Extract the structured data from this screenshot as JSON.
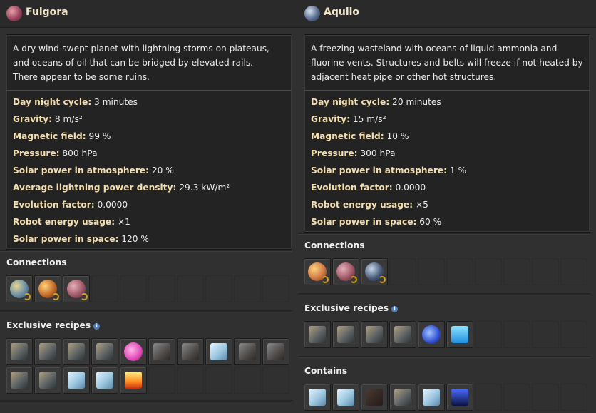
{
  "left": {
    "name": "Fulgora",
    "description": "A dry wind-swept planet with lightning storms on plateaus, and oceans of oil that can be bridged by elevated rails.\nThere appear to be some ruins.",
    "stats": [
      {
        "label": "Day night cycle:",
        "value": "3 minutes"
      },
      {
        "label": "Gravity:",
        "value": "8 m/s²"
      },
      {
        "label": "Magnetic field:",
        "value": "99 %"
      },
      {
        "label": "Pressure:",
        "value": "800 hPa"
      },
      {
        "label": "Solar power in atmosphere:",
        "value": "20 %"
      },
      {
        "label": "Average lightning power density:",
        "value": "29.3 kW/m²"
      },
      {
        "label": "Evolution factor:",
        "value": "0.0000"
      },
      {
        "label": "Robot energy usage:",
        "value": "×1"
      },
      {
        "label": "Solar power in space:",
        "value": "120 %"
      }
    ],
    "sections": [
      {
        "title": "Connections",
        "info": false,
        "items": [
          "nauvis-connection-icon",
          "vulcanus-connection-icon",
          "gleba-connection-icon"
        ]
      },
      {
        "title": "Exclusive recipes",
        "info": true,
        "items": [
          "recycler-icon",
          "electromagnetic-plant-icon",
          "tesla-turret-icon",
          "lightning-rod-icon",
          "electromagnetic-science-pack-icon",
          "holmium-ore-icon",
          "scrap-recycling-icon",
          "holmium-solution-icon",
          "holmium-plate-icon",
          "superconductor-icon",
          "supercapacitor-icon",
          "lightning-collector-icon",
          "battery-icon",
          "ice-icon",
          "fire-icon"
        ]
      }
    ]
  },
  "right": {
    "name": "Aquilo",
    "description": "A freezing wasteland with oceans of liquid ammonia and fluorine vents. Structures and belts will freeze if not heated by adjacent heat pipe or other hot structures.",
    "stats": [
      {
        "label": "Day night cycle:",
        "value": "20 minutes"
      },
      {
        "label": "Gravity:",
        "value": "15 m/s²"
      },
      {
        "label": "Magnetic field:",
        "value": "10 %"
      },
      {
        "label": "Pressure:",
        "value": "300 hPa"
      },
      {
        "label": "Solar power in atmosphere:",
        "value": "1 %"
      },
      {
        "label": "Evolution factor:",
        "value": "0.0000"
      },
      {
        "label": "Robot energy usage:",
        "value": "×5"
      },
      {
        "label": "Solar power in space:",
        "value": "60 %"
      }
    ],
    "sections": [
      {
        "title": "Connections",
        "info": false,
        "items": [
          "fulgora-connection-icon",
          "gleba-connection-icon",
          "solar-system-edge-icon"
        ]
      },
      {
        "title": "Exclusive recipes",
        "info": true,
        "items": [
          "fusion-reactor-icon",
          "fusion-generator-icon",
          "cryogenic-plant-icon",
          "quantum-processor-icon",
          "cryogenic-science-pack-icon",
          "fluoroketone-icon"
        ]
      },
      {
        "title": "Contains",
        "info": false,
        "items": [
          "ice-chunk-icon",
          "ice-platform-icon",
          "lithium-icon",
          "ammoniacal-ocean-icon",
          "ice-shard-icon",
          "fluorine-vent-icon"
        ]
      }
    ]
  },
  "colors": {
    "accent_label": "#f3deb0",
    "panel": "#242324",
    "background": "#313031"
  }
}
